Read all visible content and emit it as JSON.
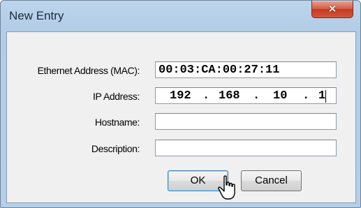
{
  "window": {
    "title": "New Entry",
    "close_glyph": "×",
    "accent_color": "#c23a22"
  },
  "form": {
    "mac_label": "Ethernet Address (MAC):",
    "mac_value": "00:03:CA:00:27:11",
    "ip_label": "IP Address:",
    "ip_octets": [
      "192",
      "168",
      "10",
      "1"
    ],
    "ip_separator": ".",
    "hostname_label": "Hostname:",
    "hostname_value": "",
    "description_label": "Description:",
    "description_value": ""
  },
  "buttons": {
    "ok_label": "OK",
    "cancel_label": "Cancel"
  },
  "icons": {
    "cursor": "hand-pointer-icon",
    "close": "close-icon"
  }
}
